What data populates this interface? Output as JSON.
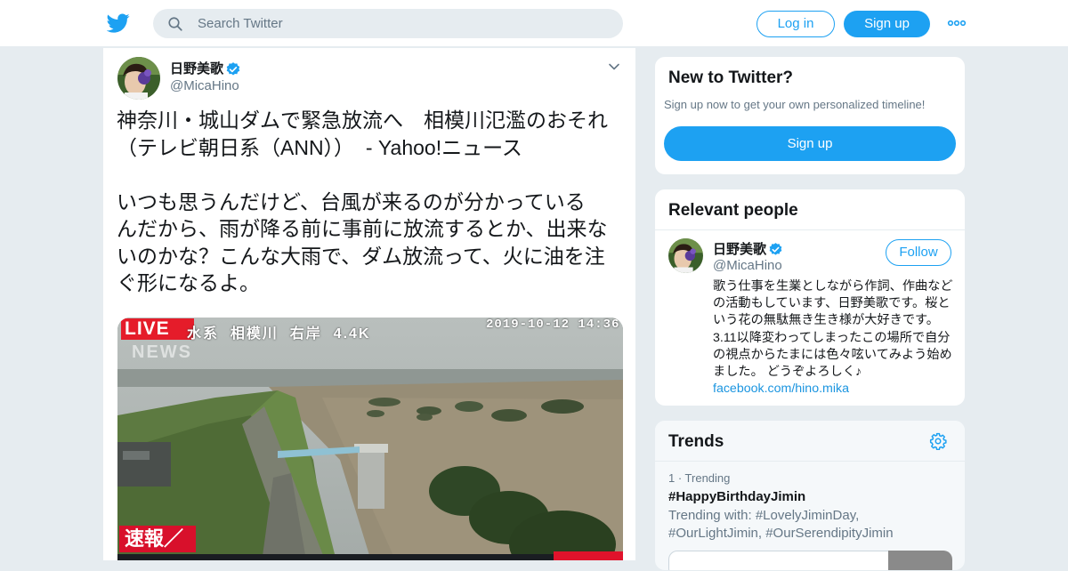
{
  "header": {
    "search_placeholder": "Search Twitter",
    "login_label": "Log in",
    "signup_label": "Sign up",
    "brand_color": "#1da1f2"
  },
  "tweet": {
    "author_name": "日野美歌",
    "author_handle": "@MicaHino",
    "verified": true,
    "text": "神奈川・城山ダムで緊急放流へ　相模川氾濫のおそれ（テレビ朝日系（ANN））-Yahoo!ニュース\n\nいつも思うんだけど、台風が来るのが分かっているんだから、雨が降る前に事前に放流するとか、出来ないのかな？こんな大雨で、ダム放流って、火に油を注ぐ形になるよ。",
    "text_display": "神奈川・城山ダムで緊急放流へ　相模川氾濫のおそれ\n（テレビ朝日系（ANN））  - Yahoo!ニュース\n\nいつも思うんだけど、台風が来るのが分かっている\nんだから、雨が降る前に事前に放流するとか、出来な\nいのかな？こんな大雨で、ダム放流って、火に油を注\nぐ形になるよ。",
    "media": {
      "live_badge": "LIVE",
      "news_label": "NEWS",
      "camera_label": "水系  相模川  右岸  4.4K",
      "camera_time": "2019-10-12 14:36",
      "breaking_label": "速報／"
    }
  },
  "sidebar": {
    "new_to_twitter": {
      "title": "New to Twitter?",
      "subtitle": "Sign up now to get your own personalized timeline!",
      "signup_label": "Sign up"
    },
    "relevant_people": {
      "title": "Relevant people",
      "name": "日野美歌",
      "handle": "@MicaHino",
      "follow_label": "Follow",
      "bio": "歌う仕事を生業としながら作詞、作曲などの活動もしています、日野美歌です。桜という花の無駄無き生き様が大好きです。3.11以降変わってしまったこの場所で自分の視点からたまには色々呟いてみよう始めました。 どうぞよろしく♪ ",
      "bio_link": "facebook.com/hino.mika"
    },
    "trends": {
      "title": "Trends",
      "items": [
        {
          "meta": "1 · Trending",
          "tag": "#HappyBirthdayJimin",
          "with": "Trending with: #LovelyJiminDay, #OurLightJimin, #OurSerendipityJimin"
        }
      ]
    }
  }
}
